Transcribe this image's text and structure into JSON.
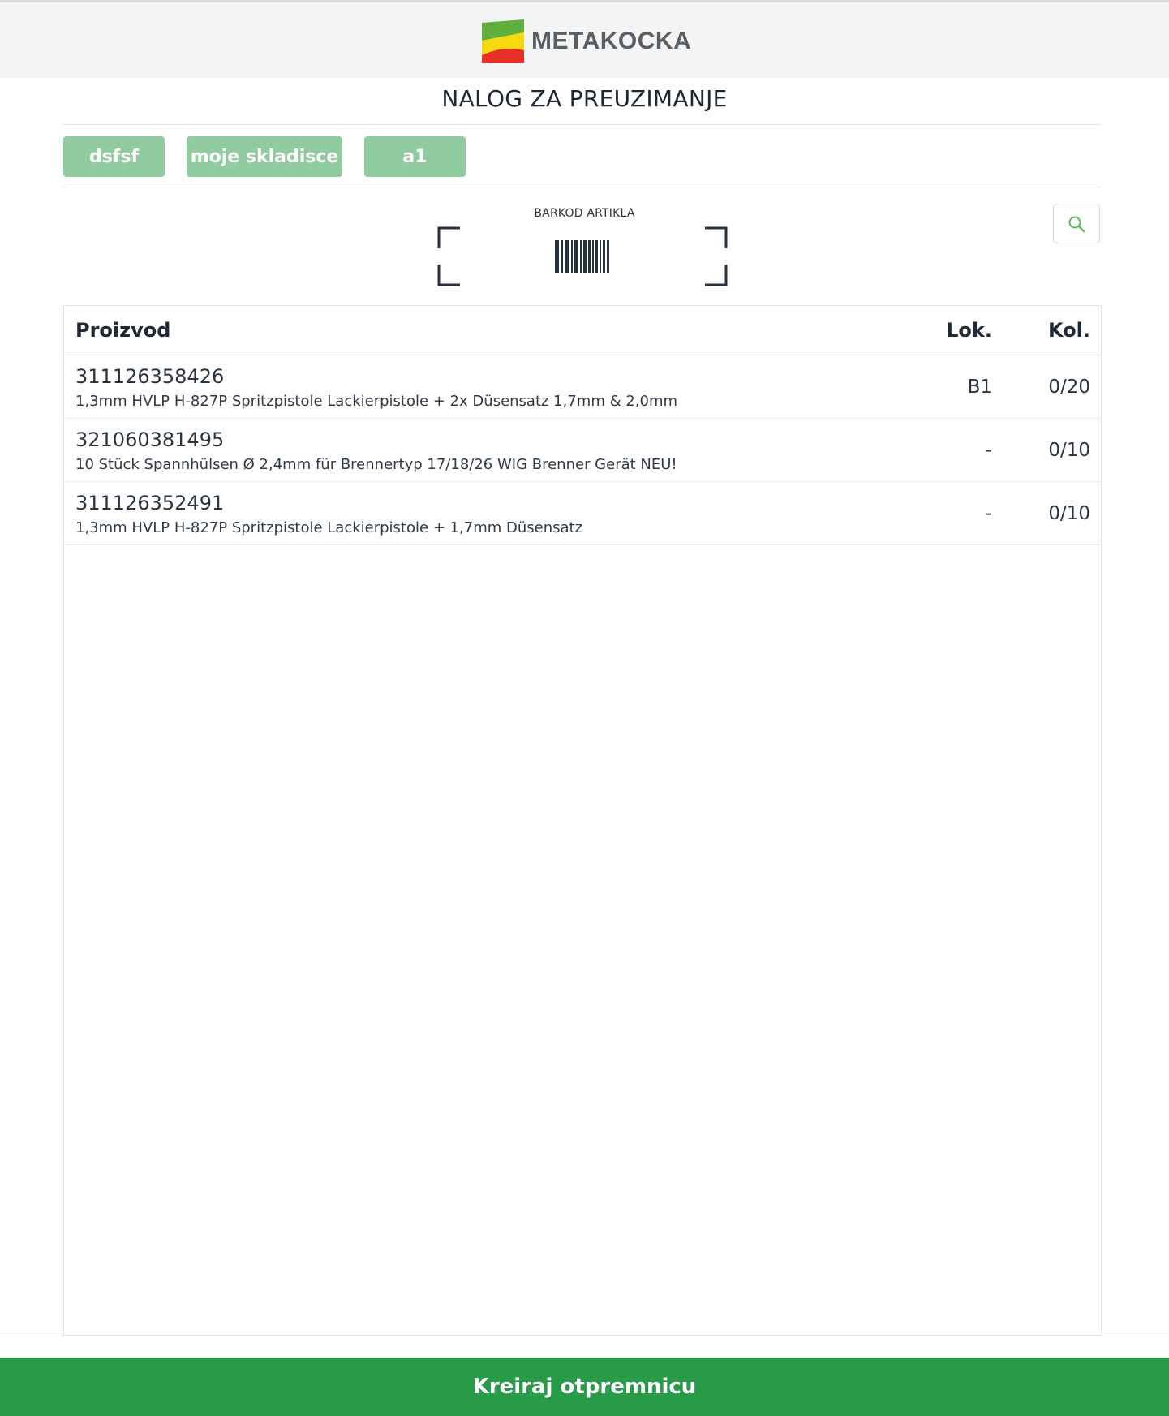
{
  "brand": {
    "name": "METAKOCKA"
  },
  "page": {
    "title": "NALOG ZA PREUZIMANJE"
  },
  "tags": [
    "dsfsf",
    "moje skladisce",
    "a1"
  ],
  "barcode": {
    "label": "BARKOD ARTIKLA"
  },
  "table": {
    "headers": {
      "product": "Proizvod",
      "location": "Lok.",
      "quantity": "Kol."
    },
    "rows": [
      {
        "code": "311126358426",
        "name": "1,3mm HVLP H-827P Spritzpistole Lackierpistole + 2x Düsensatz 1,7mm & 2,0mm",
        "location": "B1",
        "quantity": "0/20"
      },
      {
        "code": "321060381495",
        "name": "10 Stück Spannhülsen Ø 2,4mm für Brennertyp 17/18/26 WIG Brenner Gerät NEU!",
        "location": "-",
        "quantity": "0/10"
      },
      {
        "code": "311126352491",
        "name": "1,3mm HVLP H-827P Spritzpistole Lackierpistole + 1,7mm Düsensatz",
        "location": "-",
        "quantity": "0/10"
      }
    ]
  },
  "actions": {
    "create_label": "Kreiraj otpremnicu"
  },
  "colors": {
    "accent": "#289b48",
    "tag": "#90cca0",
    "search_icon": "#5cb85c"
  }
}
